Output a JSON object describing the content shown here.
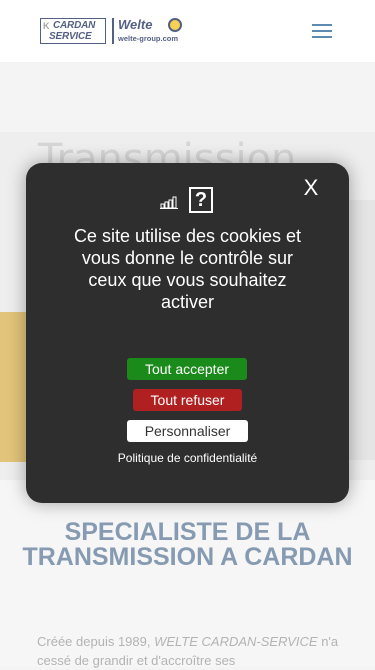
{
  "header": {
    "logo": {
      "cardan_line1": "CARDAN",
      "cardan_line2": "SERVICE",
      "welte": "Welte",
      "url": "welte-group.com"
    },
    "menu_icon": "hamburger-menu-icon"
  },
  "hero": {
    "title": "Transmission"
  },
  "cookie_modal": {
    "close_label": "X",
    "message": "Ce site utilise des cookies et vous donne le contrôle sur ceux que vous souhaitez activer",
    "help_symbol": "?",
    "accept_label": "Tout accepter",
    "refuse_label": "Tout refuser",
    "customize_label": "Personnaliser",
    "policy_label": "Politique de confidentialité",
    "colors": {
      "accept": "#1a8a1a",
      "refuse": "#b02020",
      "background": "#2e2e2e"
    }
  },
  "section": {
    "title": "SPECIALISTE DE LA TRANSMISSION A CARDAN",
    "intro_prefix": "Créée depuis 1989, ",
    "intro_brand": "WELTE CARDAN-SERVICE",
    "intro_suffix": " n'a cessé de grandir et d'accroître ses"
  }
}
